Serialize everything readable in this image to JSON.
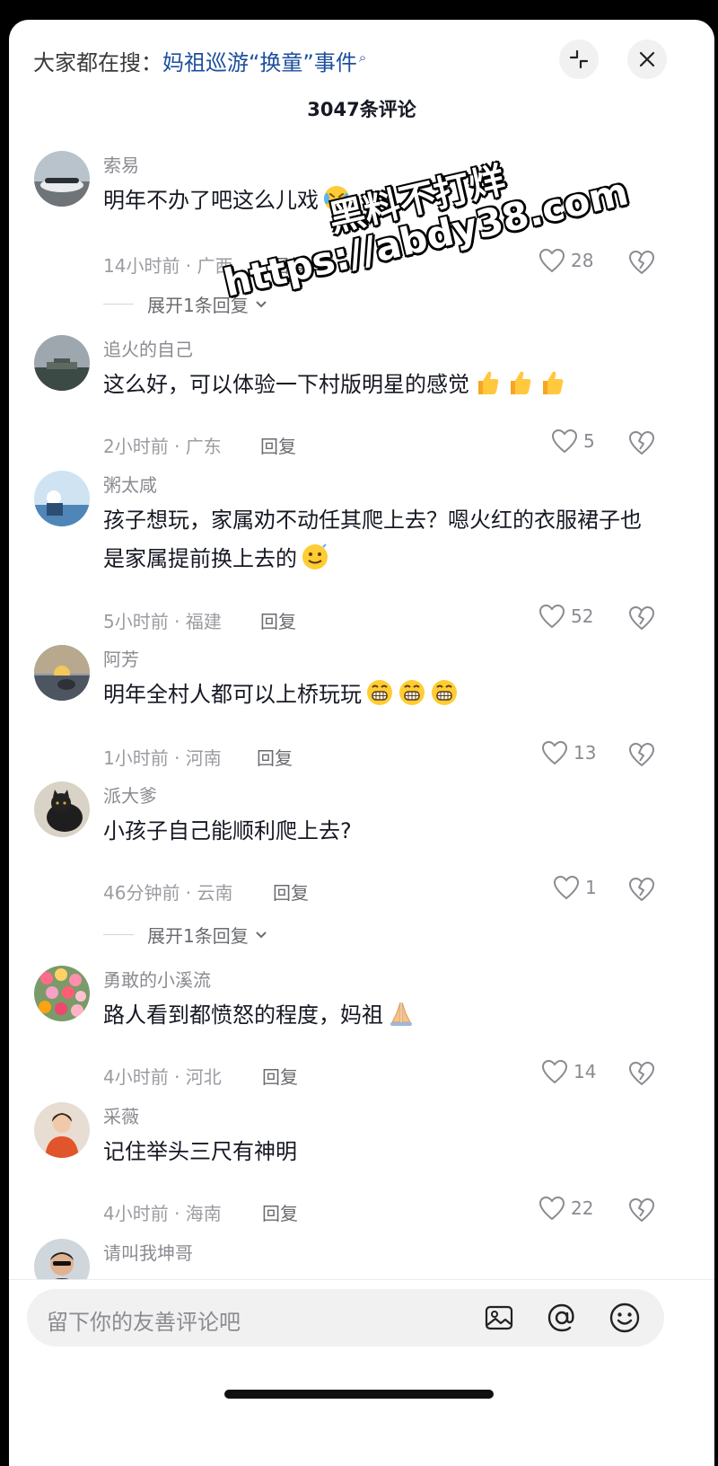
{
  "header": {
    "search_prefix": "大家都在搜：",
    "search_term": "妈祖巡游“换童”事件",
    "collapse_label": "collapse-icon",
    "close_label": "close-icon",
    "comment_count_title": "3047条评论"
  },
  "comments": [
    {
      "user": "索易",
      "text": "明年不办了吧这么儿戏",
      "emoji": [
        "crying-laughing"
      ],
      "time_location": "14小时前 · 广西",
      "reply_label": "回复",
      "likes": "28",
      "expand_label": "展开1条回复"
    },
    {
      "user": "追火的自己",
      "text": "这么好，可以体验一下村版明星的感觉",
      "emoji": [
        "thumbs-up",
        "thumbs-up",
        "thumbs-up"
      ],
      "time_location": "2小时前 · 广东",
      "reply_label": "回复",
      "likes": "5"
    },
    {
      "user": "粥太咸",
      "text": "孩子想玩，家属劝不动任其爬上去？嗯火红的衣服裙子也是家属提前换上去的",
      "emoji": [
        "awkward-smile"
      ],
      "time_location": "5小时前 · 福建",
      "reply_label": "回复",
      "likes": "52"
    },
    {
      "user": "阿芳",
      "text": "明年全村人都可以上桥玩玩",
      "emoji": [
        "grin",
        "grin",
        "grin"
      ],
      "time_location": "1小时前 · 河南",
      "reply_label": "回复",
      "likes": "13"
    },
    {
      "user": "派大爹",
      "text": "小孩子自己能顺利爬上去?",
      "emoji": [],
      "time_location": "46分钟前 · 云南",
      "reply_label": "回复",
      "likes": "1",
      "expand_label": "展开1条回复"
    },
    {
      "user": "勇敢的小溪流",
      "text": "路人看到都愤怒的程度，妈祖",
      "emoji": [
        "praying-hands"
      ],
      "time_location": "4小时前 · 河北",
      "reply_label": "回复",
      "likes": "14"
    },
    {
      "user": "采薇",
      "text": "记住举头三尺有神明",
      "emoji": [],
      "time_location": "4小时前 · 海南",
      "reply_label": "回复",
      "likes": "22"
    },
    {
      "user": "请叫我坤哥",
      "text": "",
      "emoji": []
    }
  ],
  "footer": {
    "input_placeholder": "留下你的友善评论吧",
    "image_icon": "image-icon",
    "mention_icon": "at-mention-icon",
    "emoji_icon": "emoji-icon"
  },
  "watermark": {
    "line1": "黑料不打烊",
    "line2": "https://abdy38.com"
  },
  "colors": {
    "primary_text": "#161823",
    "secondary_text": "#8a8b91",
    "search_link": "#1d4f9c",
    "background": "#ffffff"
  }
}
